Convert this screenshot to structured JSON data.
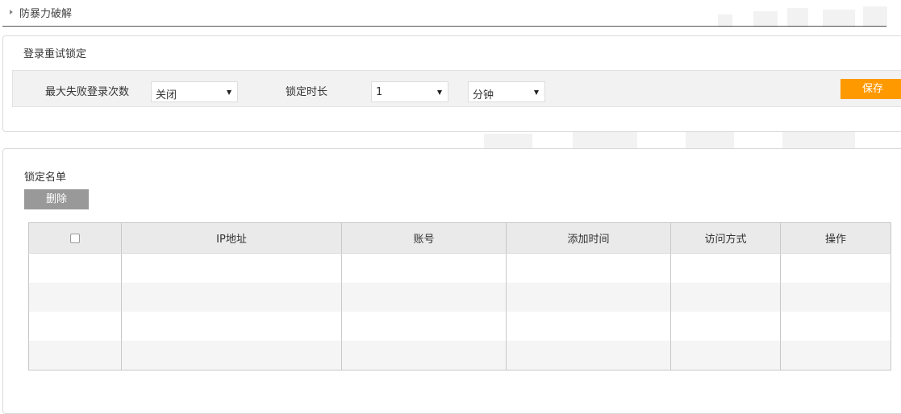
{
  "breadcrumb": {
    "title": "防暴力破解"
  },
  "login_retry": {
    "section_title": "登录重试锁定",
    "max_fail_label": "最大失败登录次数",
    "max_fail_value": "关闭",
    "lock_duration_label": "锁定时长",
    "lock_duration_value": "1",
    "lock_unit_value": "分钟",
    "save_label": "保存"
  },
  "lock_list": {
    "section_title": "锁定名单",
    "delete_label": "删除",
    "columns": [
      "IP地址",
      "账号",
      "添加时间",
      "访问方式",
      "操作"
    ],
    "rows": []
  },
  "colors": {
    "accent": "#ff9900",
    "delete_button": "#999999",
    "table_header_bg": "#eaeaea"
  }
}
